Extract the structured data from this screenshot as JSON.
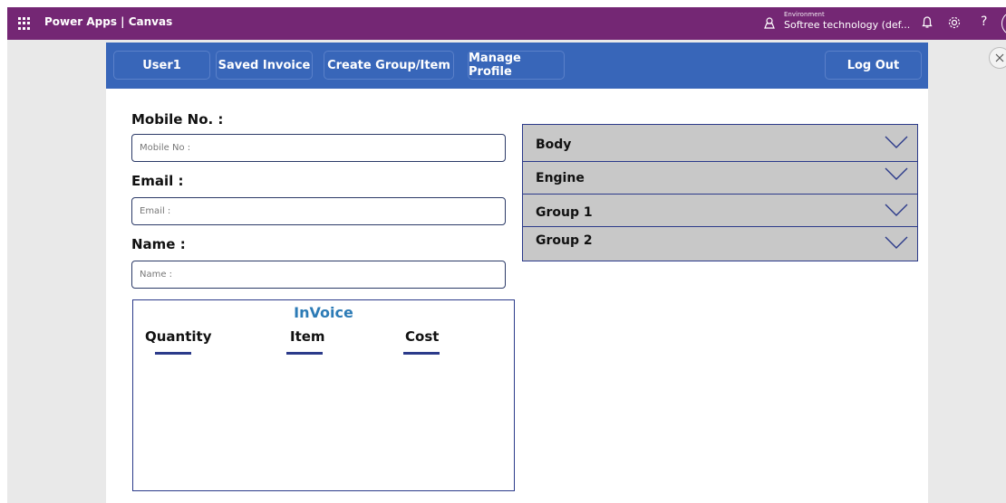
{
  "topbar": {
    "app_title": "Power Apps | Canvas",
    "environment_label": "Environment",
    "environment_name": "Softree technology (def...",
    "help_glyph": "?",
    "icons": [
      "waffle-icon",
      "environment-icon",
      "bell-icon",
      "gear-icon",
      "help-icon",
      "avatar"
    ]
  },
  "nav": {
    "buttons": [
      {
        "label": "User1"
      },
      {
        "label": "Saved Invoice"
      },
      {
        "label": "Create Group/Item"
      },
      {
        "label": "Manage Profile"
      },
      {
        "label": "Log Out"
      }
    ]
  },
  "form": {
    "mobile": {
      "label": "Mobile No. :",
      "placeholder": "Mobile No :",
      "value": ""
    },
    "email": {
      "label": "Email :",
      "placeholder": "Email :",
      "value": ""
    },
    "name": {
      "label": "Name :",
      "placeholder": "Name :",
      "value": ""
    }
  },
  "invoice": {
    "title": "InVoice",
    "columns": [
      "Quantity",
      "Item",
      "Cost"
    ]
  },
  "groups": {
    "items": [
      {
        "label": "Body"
      },
      {
        "label": "Engine"
      },
      {
        "label": "Group 1"
      },
      {
        "label": "Group 2"
      }
    ]
  },
  "colors": {
    "topbar": "#742774",
    "navbar": "#3866b9",
    "accordion": "#c8c8c8",
    "invoice_title": "#2c7bb6",
    "border": "#2b3a8a"
  }
}
